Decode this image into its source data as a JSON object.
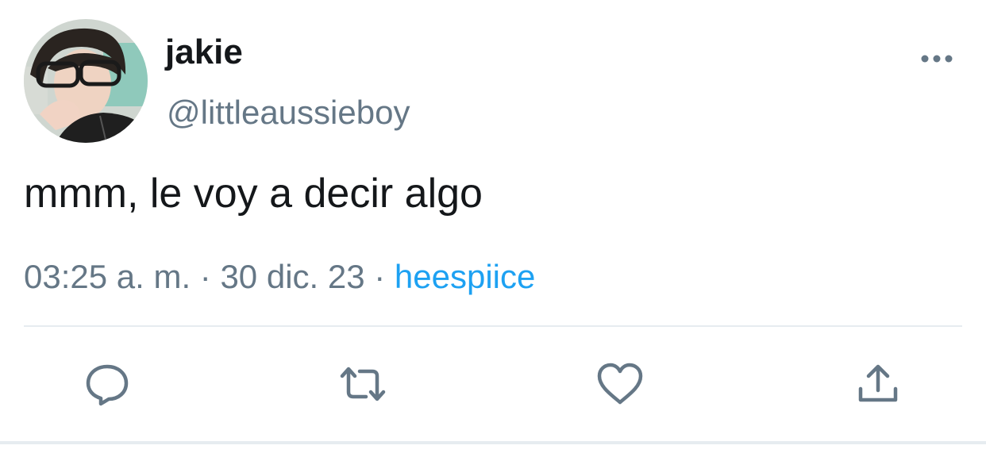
{
  "tweet": {
    "author": {
      "display_name": "jakie",
      "handle": "@littleaussieboy"
    },
    "text": "mmm, le voy a decir algo",
    "meta": {
      "time": "03:25 a. m.",
      "separator": " · ",
      "date": "30 dic. 23",
      "source": "heespiice"
    }
  },
  "icons": {
    "more": "more-horizontal-icon",
    "reply": "reply-icon",
    "retweet": "retweet-icon",
    "like": "heart-icon",
    "share": "share-icon"
  },
  "colors": {
    "text_primary": "#14171a",
    "text_secondary": "#657786",
    "accent": "#1da1f2",
    "divider": "#e6ecf0"
  }
}
